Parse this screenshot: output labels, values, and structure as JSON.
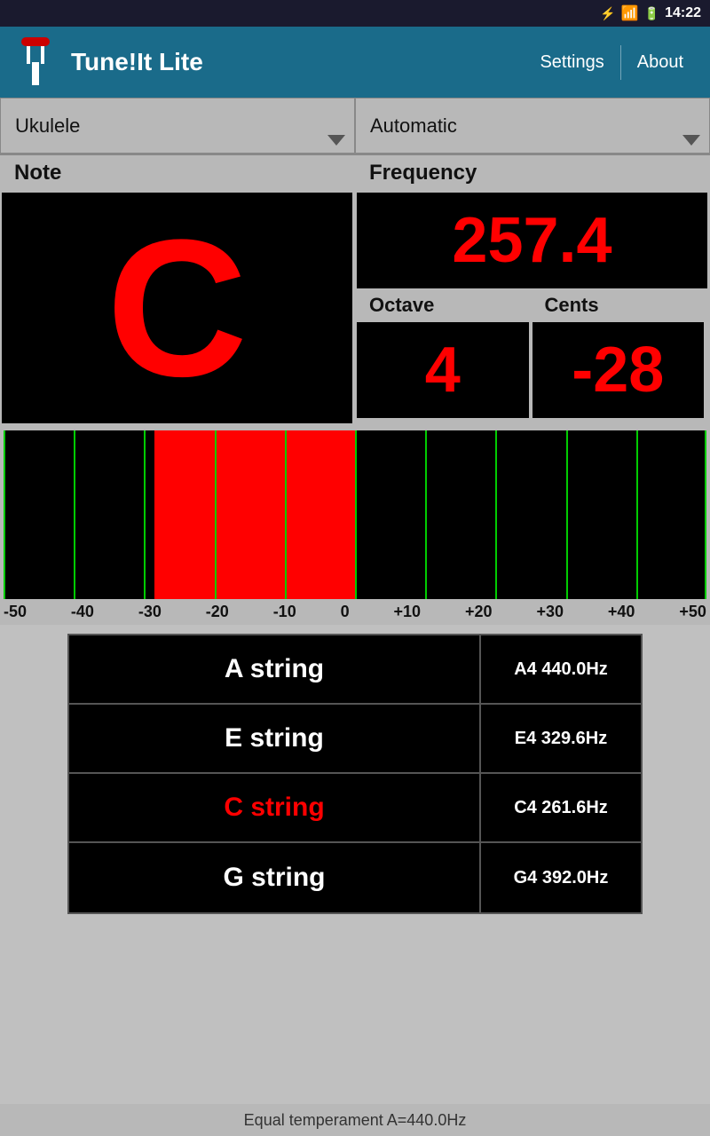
{
  "status_bar": {
    "time": "14:22"
  },
  "top_bar": {
    "title": "Tune!It Lite",
    "settings_label": "Settings",
    "about_label": "About"
  },
  "selectors": {
    "instrument": "Ukulele",
    "mode": "Automatic"
  },
  "note_display": {
    "note_label": "Note",
    "note_value": "C",
    "freq_label": "Frequency",
    "freq_value": "257.4",
    "octave_label": "Octave",
    "octave_value": "4",
    "cents_label": "Cents",
    "cents_value": "-28"
  },
  "meter": {
    "scale": [
      "-50",
      "-40",
      "-30",
      "-20",
      "-10",
      "0",
      "+10",
      "+20",
      "+30",
      "+40",
      "+50"
    ]
  },
  "strings": [
    {
      "name": "A string",
      "info": "A4  440.0Hz",
      "active": false
    },
    {
      "name": "E string",
      "info": "E4  329.6Hz",
      "active": false
    },
    {
      "name": "C string",
      "info": "C4  261.6Hz",
      "active": true
    },
    {
      "name": "G string",
      "info": "G4  392.0Hz",
      "active": false
    }
  ],
  "footer": {
    "text": "Equal temperament   A=440.0Hz"
  }
}
